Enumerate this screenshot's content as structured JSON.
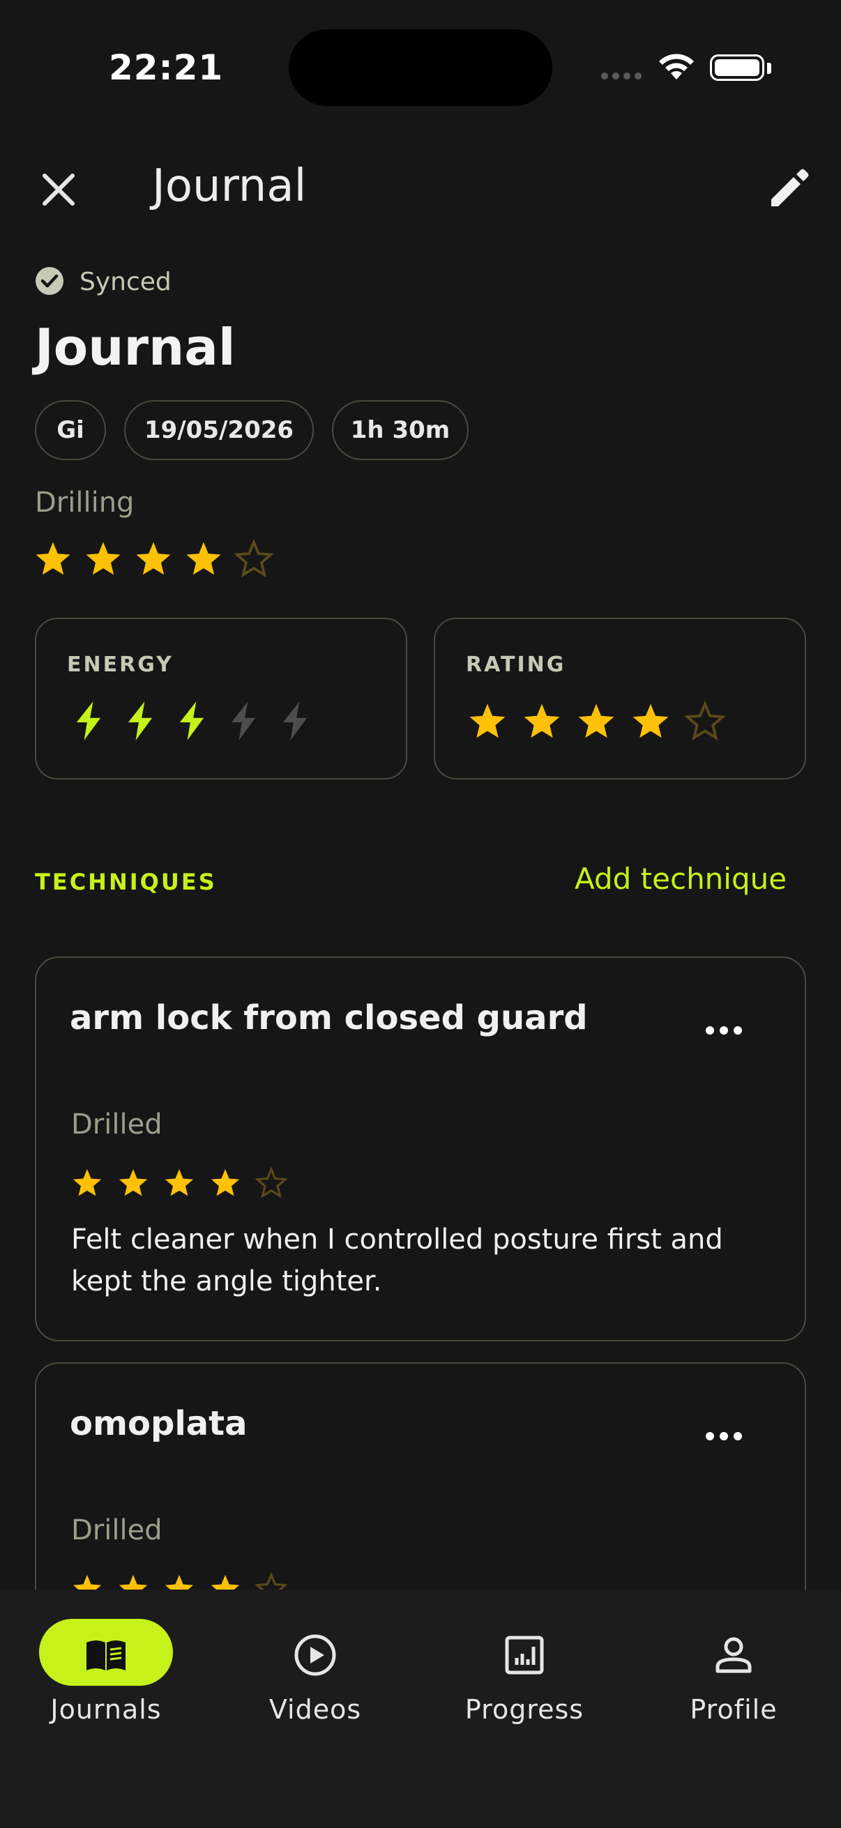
{
  "status_bar": {
    "time": "22:21"
  },
  "header": {
    "title": "Journal"
  },
  "sync": {
    "status": "Synced"
  },
  "journal": {
    "title": "Journal",
    "chips": {
      "type": "Gi",
      "date": "19/05/2026",
      "duration": "1h 30m"
    },
    "drilling": {
      "label": "Drilling",
      "rating": 4,
      "max": 5
    }
  },
  "stats": {
    "energy": {
      "label": "ENERGY",
      "value": 3,
      "max": 5
    },
    "rating": {
      "label": "RATING",
      "value": 4,
      "max": 5
    }
  },
  "techniques": {
    "label": "TECHNIQUES",
    "add_label": "Add technique",
    "items": [
      {
        "name": "arm lock from closed guard",
        "status": "Drilled",
        "rating": 4,
        "note": "Felt cleaner when I controlled posture first and kept the angle tighter."
      },
      {
        "name": "omoplata",
        "status": "Drilled",
        "rating": 4,
        "note": ""
      }
    ]
  },
  "nav": {
    "items": [
      {
        "label": "Journals",
        "icon": "book-icon",
        "active": true
      },
      {
        "label": "Videos",
        "icon": "play-circle-icon",
        "active": false
      },
      {
        "label": "Progress",
        "icon": "chart-icon",
        "active": false
      },
      {
        "label": "Profile",
        "icon": "person-icon",
        "active": false
      }
    ]
  },
  "colors": {
    "accent": "#c6f11a",
    "star": "#ffc107",
    "star_empty": "#5a4a1a",
    "background": "#161616"
  }
}
